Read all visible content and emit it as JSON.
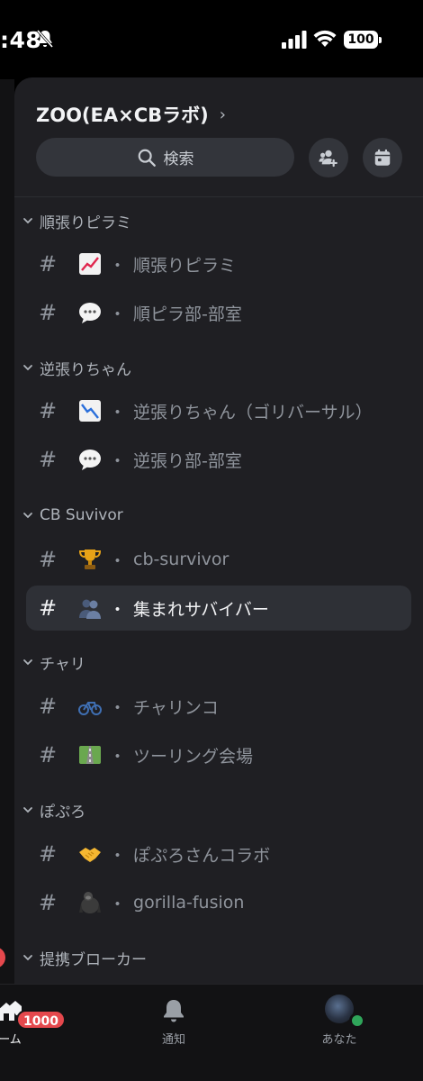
{
  "status_bar": {
    "time": ":48",
    "battery": "100"
  },
  "server": {
    "name": "ZOO(EA×CBラボ)",
    "chevron": "›",
    "search_label": "検索"
  },
  "categories": [
    {
      "label": "順張りピラミ",
      "channels": [
        {
          "emoji": "chart-up-icon",
          "name": "順張りピラミ"
        },
        {
          "emoji": "speech-bubble-icon",
          "name": "順ピラ部-部室"
        }
      ]
    },
    {
      "label": "逆張りちゃん",
      "channels": [
        {
          "emoji": "chart-down-icon",
          "name": "逆張りちゃん（ゴリバーサル）"
        },
        {
          "emoji": "speech-bubble-icon",
          "name": "逆張り部-部室"
        }
      ]
    },
    {
      "label": "CB Suvivor",
      "channels": [
        {
          "emoji": "trophy-icon",
          "name": "cb-survivor"
        },
        {
          "emoji": "people-icon",
          "name": "集まれサバイバー"
        }
      ]
    },
    {
      "label": "チャリ",
      "channels": [
        {
          "emoji": "bicycle-icon",
          "name": "チャリンコ"
        },
        {
          "emoji": "road-icon",
          "name": "ツーリング会場"
        }
      ]
    },
    {
      "label": "ぽぷろ",
      "channels": [
        {
          "emoji": "handshake-icon",
          "name": "ぽぷろさんコラボ"
        },
        {
          "emoji": "gorilla-icon",
          "name": "gorilla-fusion"
        }
      ]
    },
    {
      "label": "提携ブローカー",
      "channels": []
    }
  ],
  "channel_prefix": "#",
  "channel_separator": "・",
  "tabs": {
    "home_label": "ーム",
    "home_badge": "1000",
    "notifications_label": "通知",
    "you_label": "あなた"
  },
  "colors": {
    "panel_bg": "#1f1f23",
    "active_channel_bg": "#2e3036",
    "badge_red": "#e5484d",
    "online_green": "#2fa55a"
  }
}
